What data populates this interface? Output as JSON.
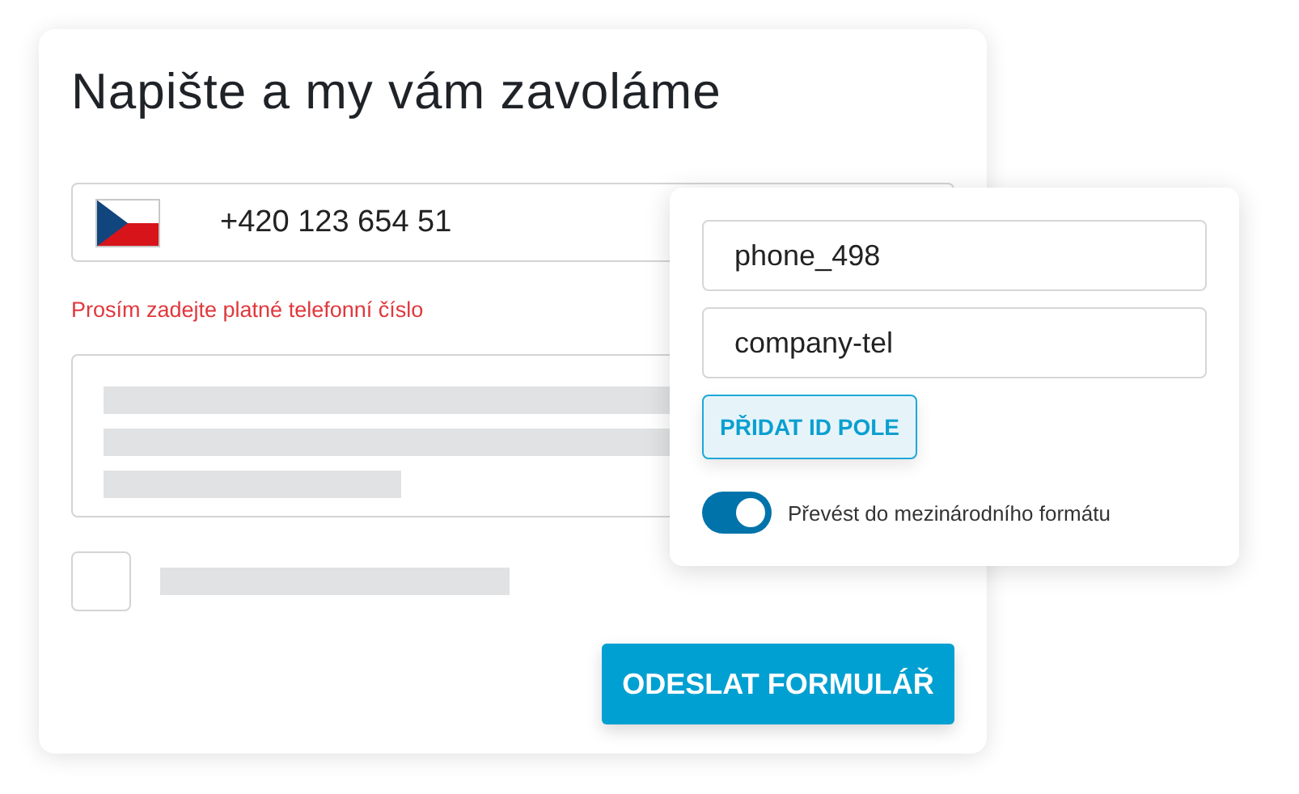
{
  "form": {
    "title": "Napište a my vám zavoláme",
    "phone": {
      "value": "+420 123 654 51"
    },
    "error": "Prosím zadejte platné telefonní číslo",
    "consent_checkbox": {
      "checked": false
    },
    "submit_button": "ODESLAT FORMULÁŘ"
  },
  "popover": {
    "field_ids": [
      "phone_498",
      "company-tel"
    ],
    "add_button": "PŘIDAT ID POLE",
    "toggle": {
      "on": true,
      "label": "Převést do mezinárodního formátu"
    }
  }
}
